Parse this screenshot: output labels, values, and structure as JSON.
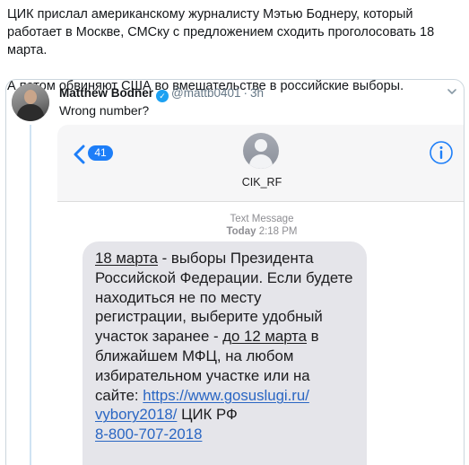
{
  "post": {
    "line1": "ЦИК прислал американскому журналисту Мэтью Боднеру, который работает в Москве, СМСку с предложением сходить проголосовать 18 марта.",
    "line2": "А потом обвиняют США во вмешательстве в российские выборы."
  },
  "quoted_tweet": {
    "author_name": "Matthew Bodner",
    "verified": true,
    "handle": "@mattb0401",
    "separator": "·",
    "time": "3h",
    "text": "Wrong number?"
  },
  "sms_screenshot": {
    "back_count": "41",
    "contact_name": "CIK_RF",
    "message_label": "Text Message",
    "day": "Today",
    "time": "2:18 PM",
    "message": {
      "date_underlined": "18 марта",
      "part1": " - выборы Президента Российской Федерации. Если будете находиться не по месту регистрации, выберите удобный участок заранее - ",
      "deadline_underlined": "до 12 марта",
      "part2": " в ближайшем МФЦ, на любом избирательном участке или на сайте: ",
      "link_part1": "https://www.gosuslugi.ru/",
      "link_part2": "vybory2018/",
      "signature": " ЦИК РФ ",
      "phone": "8-800-707-2018"
    }
  },
  "colors": {
    "twitter_blue": "#1da1f2",
    "imessage_blue": "#1d7ef8",
    "bubble_gray": "#e5e5ea",
    "link_blue": "#2a66c3"
  },
  "icons": [
    "verified-badge-icon",
    "caret-down-icon",
    "back-chevron-icon",
    "contact-avatar-icon",
    "info-icon"
  ]
}
